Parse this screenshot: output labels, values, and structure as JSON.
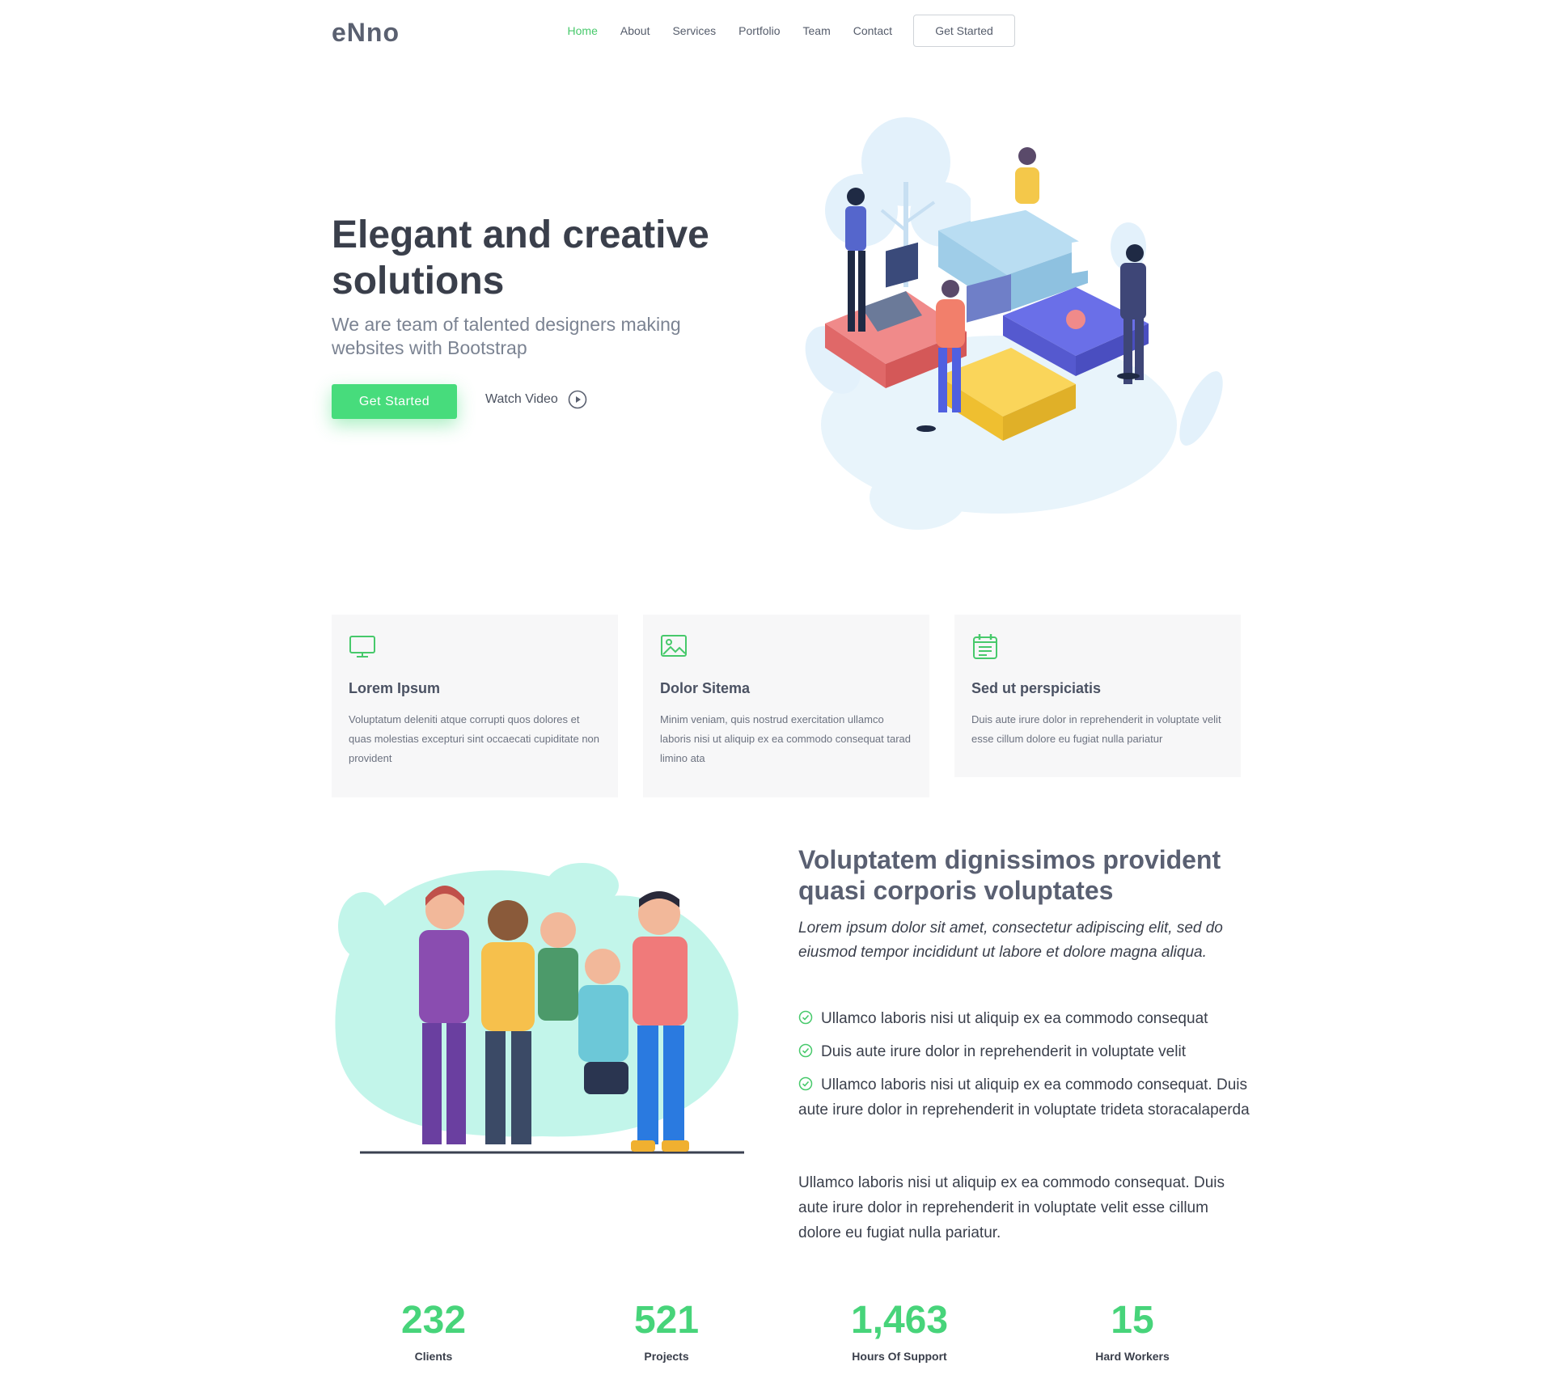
{
  "header": {
    "logo": "eNno",
    "nav": [
      {
        "label": "Home",
        "active": true
      },
      {
        "label": "About",
        "active": false
      },
      {
        "label": "Services",
        "active": false
      },
      {
        "label": "Portfolio",
        "active": false
      },
      {
        "label": "Team",
        "active": false
      },
      {
        "label": "Contact",
        "active": false
      }
    ],
    "cta": "Get Started"
  },
  "hero": {
    "title": "Elegant and creative solutions",
    "subtitle": "We are team of talented designers making websites with Bootstrap",
    "primary_button": "Get Started",
    "watch_video": "Watch Video"
  },
  "features": [
    {
      "icon": "monitor-icon",
      "title": "Lorem Ipsum",
      "text": "Voluptatum deleniti atque corrupti quos dolores et quas molestias excepturi sint occaecati cupiditate non provident"
    },
    {
      "icon": "image-icon",
      "title": "Dolor Sitema",
      "text": "Minim veniam, quis nostrud exercitation ullamco laboris nisi ut aliquip ex ea commodo consequat tarad limino ata"
    },
    {
      "icon": "calendar-icon",
      "title": "Sed ut perspiciatis",
      "text": "Duis aute irure dolor in reprehenderit in voluptate velit esse cillum dolore eu fugiat nulla pariatur"
    }
  ],
  "about": {
    "title": "Voluptatem dignissimos provident quasi corporis voluptates",
    "lead": "Lorem ipsum dolor sit amet, consectetur adipiscing elit, sed do eiusmod tempor incididunt ut labore et dolore magna aliqua.",
    "checks": [
      "Ullamco laboris nisi ut aliquip ex ea commodo consequat",
      "Duis aute irure dolor in reprehenderit in voluptate velit",
      "Ullamco laboris nisi ut aliquip ex ea commodo consequat. Duis aute irure dolor in reprehenderit in voluptate trideta storacalaperda"
    ],
    "paragraph": "Ullamco laboris nisi ut aliquip ex ea commodo consequat. Duis aute irure dolor in reprehenderit in voluptate velit esse cillum dolore eu fugiat nulla pariatur."
  },
  "stats": [
    {
      "value": "232",
      "label": "Clients"
    },
    {
      "value": "521",
      "label": "Projects"
    },
    {
      "value": "1,463",
      "label": "Hours Of Support"
    },
    {
      "value": "15",
      "label": "Hard Workers"
    }
  ],
  "colors": {
    "accent": "#47dc7c",
    "text_dark": "#3a3f4b",
    "text_muted": "#7b8392",
    "card_bg": "#f7f7f8"
  }
}
